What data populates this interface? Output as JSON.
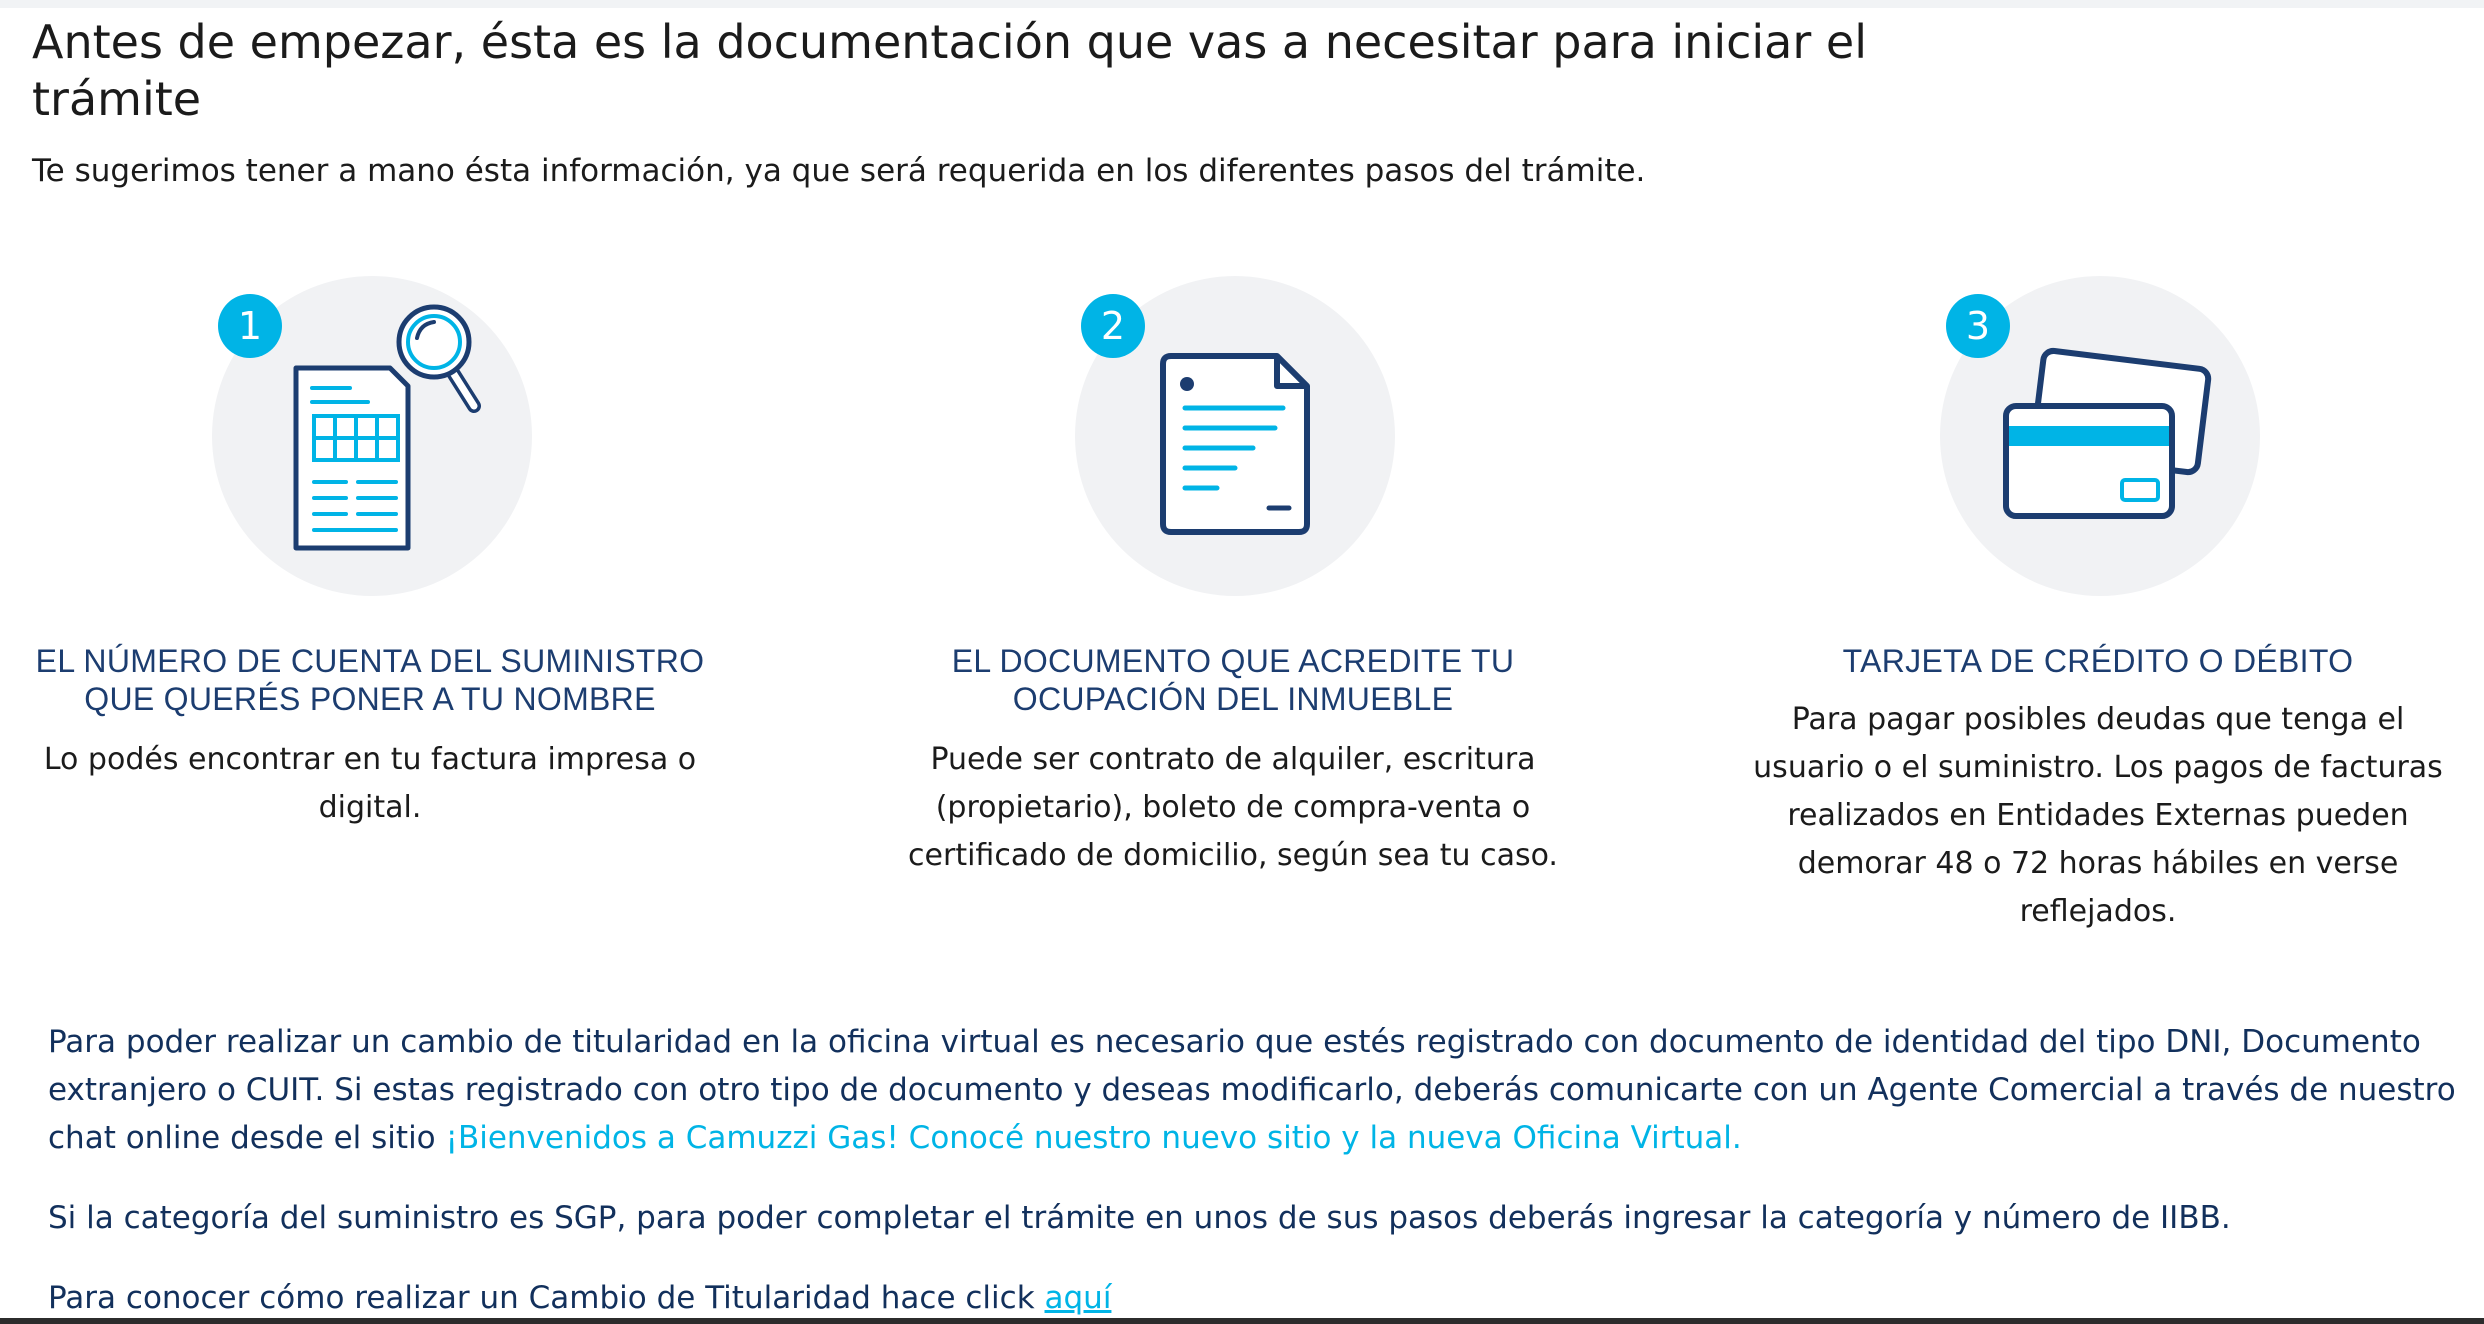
{
  "header": {
    "title": "Antes de empezar, ésta es la documentación que vas a necesitar para iniciar el trámite",
    "subtitle": "Te sugerimos tener a mano ésta información, ya que será requerida en los diferentes pasos del trámite."
  },
  "steps": [
    {
      "number": "1",
      "icon": "invoice-search-icon",
      "heading_line1": "EL NÚMERO DE CUENTA DEL SUMINISTRO",
      "heading_line2": "QUE QUERÉS PONER A TU NOMBRE",
      "text": "Lo podés encontrar en tu factura impresa o digital."
    },
    {
      "number": "2",
      "icon": "document-icon",
      "heading_line1": "EL DOCUMENTO QUE ACREDITE TU",
      "heading_line2": "OCUPACIÓN DEL INMUEBLE",
      "text": "Puede ser contrato de alquiler, escritura (propietario), boleto de compra-venta o certificado de domicilio, según sea tu caso."
    },
    {
      "number": "3",
      "icon": "credit-card-icon",
      "heading_line1": "TARJETA DE CRÉDITO O DÉBITO",
      "heading_line2": "",
      "text": "Para pagar posibles deudas que tenga el usuario o el suministro. Los pagos de facturas realizados en Entidades Externas pueden demorar 48 o 72 horas hábiles en verse reflejados."
    }
  ],
  "info": {
    "p1_text": "Para poder realizar un cambio de titularidad en la oficina virtual es necesario que estés registrado con documento de identidad del tipo DNI, Documento extranjero o CUIT. Si estas registrado con otro tipo de documento y deseas modificarlo, deberás comunicarte con un Agente Comercial a través de nuestro chat online desde el sitio ",
    "p1_link": "¡Bienvenidos a Camuzzi Gas! Conocé nuestro nuevo sitio y la nueva Oficina Virtual.",
    "p2_text": "Si la categoría del suministro es SGP, para poder completar el trámite en unos de sus pasos deberás ingresar la categoría y número de IIBB.",
    "p3_text": "Para conocer cómo realizar un Cambio de Titularidad hace click ",
    "p3_link": "aquí"
  },
  "colors": {
    "accent": "#00b4e6",
    "navy": "#1c3d70",
    "circle": "#f1f2f4"
  }
}
